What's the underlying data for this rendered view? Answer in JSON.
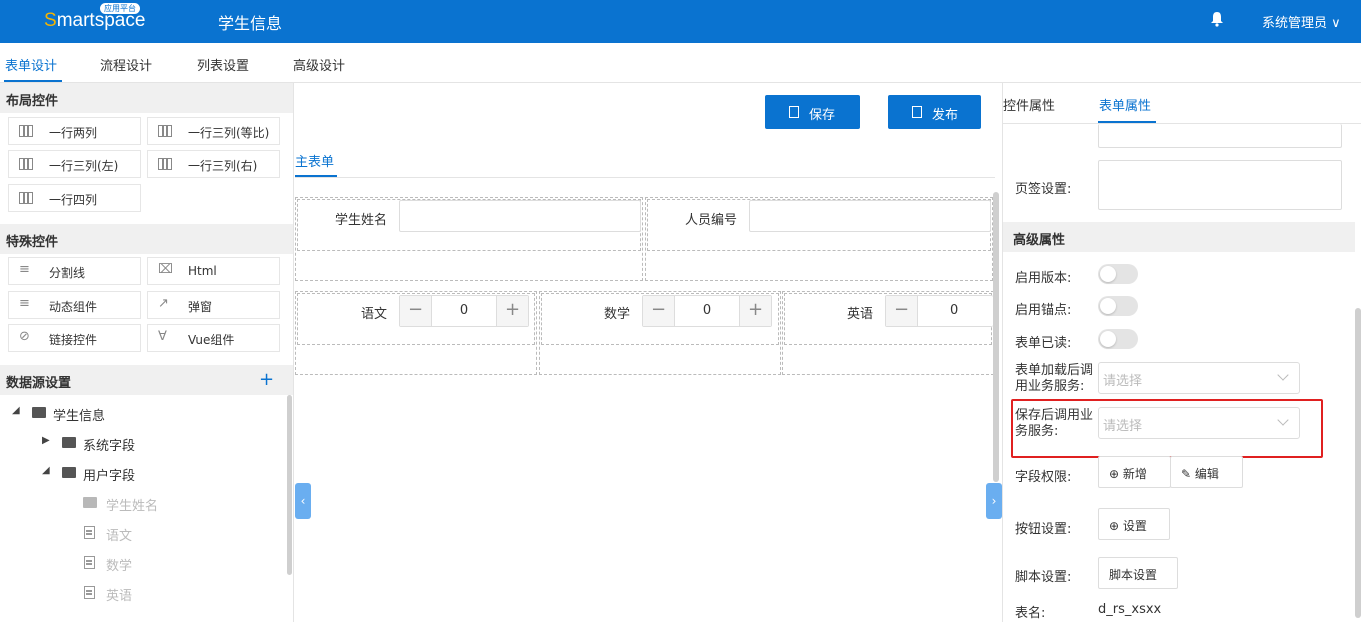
{
  "header": {
    "logo_text": "Smartspace",
    "logo_badge": "应用平台",
    "app_title": "学生信息",
    "user": "系统管理员",
    "brand_color": "#0a73d0"
  },
  "main_tabs": [
    "表单设计",
    "流程设计",
    "列表设置",
    "高级设计"
  ],
  "left_panel": {
    "layout_title": "布局控件",
    "layout_controls": [
      "一行两列",
      "一行三列(等比)",
      "一行三列(左)",
      "一行三列(右)",
      "一行四列"
    ],
    "special_title": "特殊控件",
    "special_controls": [
      "分割线",
      "Html",
      "动态组件",
      "弹窗",
      "链接控件",
      "Vue组件"
    ],
    "datasource_title": "数据源设置",
    "tree": {
      "root": "学生信息",
      "system_fields": "系统字段",
      "user_fields": "用户字段",
      "items": [
        "学生姓名",
        "语文",
        "数学",
        "英语"
      ]
    }
  },
  "center": {
    "save_label": "保存",
    "publish_label": "发布",
    "subtab": "主表单",
    "fields": {
      "name_label": "学生姓名",
      "id_label": "人员编号",
      "chinese_label": "语文",
      "math_label": "数学",
      "english_label": "英语",
      "chinese_value": "0",
      "math_value": "0",
      "english_value": "0"
    }
  },
  "right_panel": {
    "tabs": [
      "控件属性",
      "表单属性"
    ],
    "signature_label": "页签设置:",
    "advanced_title": "高级属性",
    "enable_version": "启用版本:",
    "enable_anchor": "启用锚点:",
    "form_readonly": "表单已读:",
    "after_load_label": "表单加载后调用业务服务:",
    "after_load_placeholder": "请选择",
    "after_save_label": "保存后调用业务服务:",
    "after_save_placeholder": "请选择",
    "field_perm_label": "字段权限:",
    "add_label": "新增",
    "edit_label": "编辑",
    "button_setting_label": "按钮设置:",
    "setting_label": "设置",
    "script_setting_label": "脚本设置:",
    "script_button": "脚本设置",
    "table_name_label": "表名:",
    "table_name_value": "d_rs_xsxx"
  }
}
